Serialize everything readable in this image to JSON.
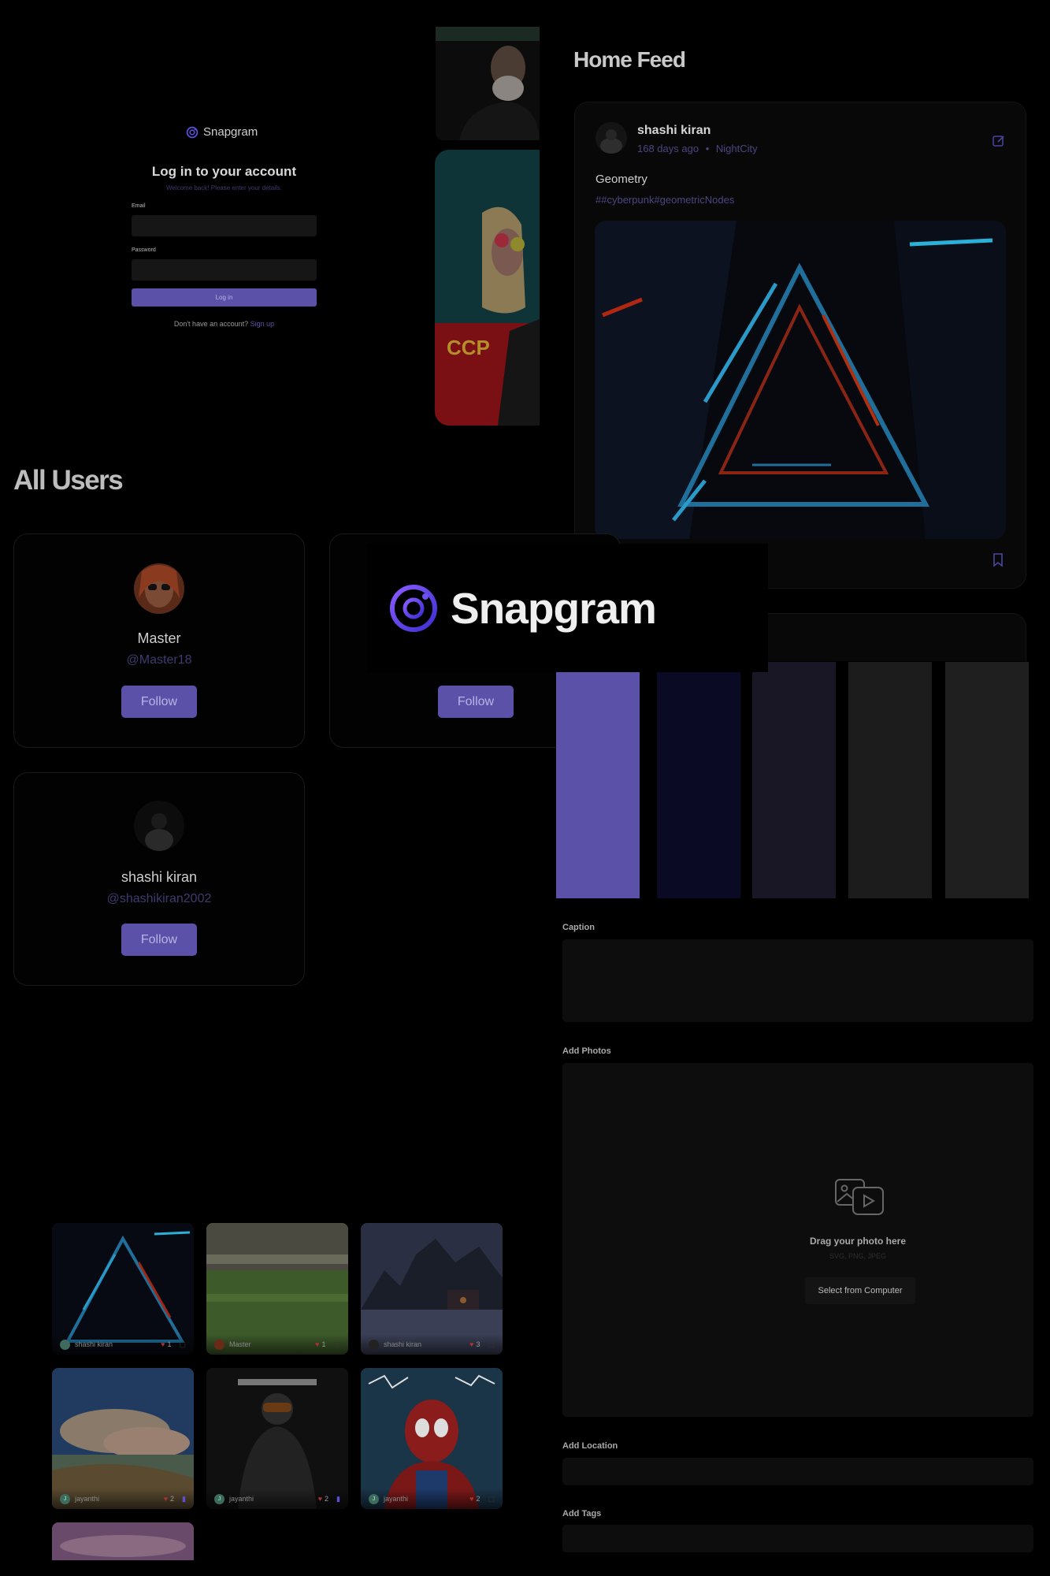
{
  "login": {
    "brand": "Snapgram",
    "title": "Log in to your account",
    "subtitle": "Welcome back! Please enter your details.",
    "email_label": "Email",
    "password_label": "Password",
    "submit_label": "Log in",
    "signup_prompt": "Don't have an account?",
    "signup_link": "Sign up"
  },
  "feed": {
    "title": "Home Feed",
    "post": {
      "author": "shashi kiran",
      "time": "168 days ago",
      "location": "NightCity",
      "caption": "Geometry",
      "tags": "##cyberpunk#geometricNodes"
    }
  },
  "users": {
    "title": "All Users",
    "cards": [
      {
        "name": "Master",
        "handle": "@Master18",
        "follow_label": "Follow"
      },
      {
        "name": "",
        "handle": "",
        "follow_label": "Follow"
      },
      {
        "name": "shashi kiran",
        "handle": "@shashikiran2002",
        "follow_label": "Follow"
      }
    ]
  },
  "brand_overlay": {
    "name": "Snapgram"
  },
  "palette": [
    "#5b51a8",
    "#0b0a24",
    "#191726",
    "#1c1c1c",
    "#1f1f1f"
  ],
  "create_post": {
    "caption_label": "Caption",
    "photos_label": "Add Photos",
    "drag_text": "Drag your photo here",
    "formats": "SVG, PNG, JPEG",
    "select_button": "Select from Computer",
    "location_label": "Add Location",
    "tags_label": "Add Tags"
  },
  "explore": [
    {
      "user": "shashi kiran",
      "likes": "1",
      "avatar": ""
    },
    {
      "user": "Master",
      "likes": "1",
      "avatar": ""
    },
    {
      "user": "shashi kiran",
      "likes": "3",
      "avatar": ""
    },
    {
      "user": "jayanthi",
      "likes": "2",
      "avatar": "J"
    },
    {
      "user": "jayanthi",
      "likes": "2",
      "avatar": "J"
    },
    {
      "user": "jayanthi",
      "likes": "2",
      "avatar": "J"
    }
  ]
}
